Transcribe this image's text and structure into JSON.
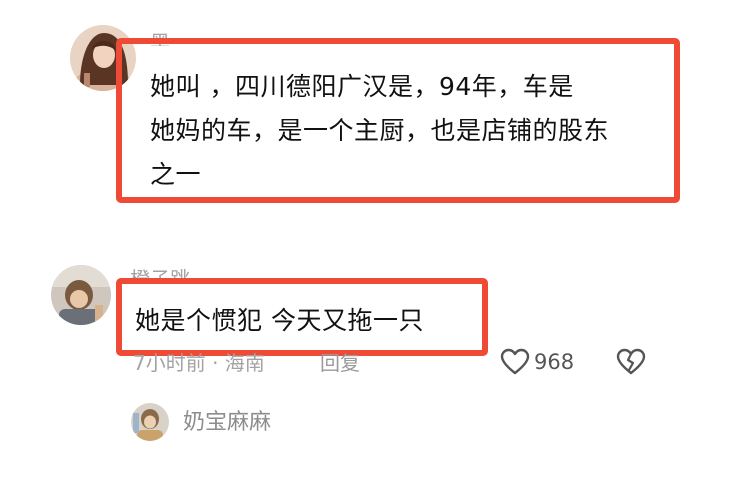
{
  "comments": [
    {
      "username": "黑",
      "text_lines": [
        "她叫        ，四川德阳广汉是，94年，车是",
        "她妈的车，是一个主厨，也是店铺的股东",
        "之一"
      ]
    },
    {
      "username": "橙子跳",
      "text": "她是个惯犯 今天又拖一只",
      "time": "7小时前 · 海南",
      "reply_label": "回复",
      "like_count": "968"
    }
  ],
  "sub_reply": {
    "username": "奶宝麻麻"
  },
  "colors": {
    "highlight": "#ee4a35",
    "meta_text": "#a3a3a3",
    "body_text": "#111111"
  },
  "icons": {
    "like": "heart-outline-icon",
    "dislike": "broken-heart-icon"
  }
}
